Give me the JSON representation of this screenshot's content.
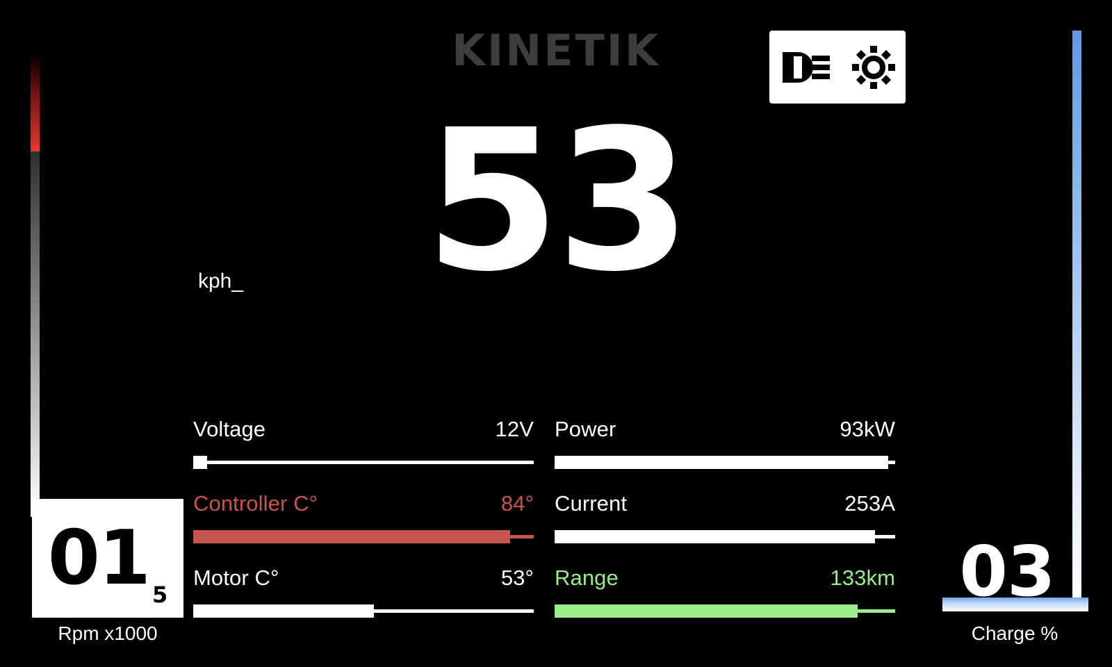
{
  "brand": {
    "name": "KINETIK"
  },
  "lights": {
    "low_beam_icon": "headlight-low-beam-icon",
    "brightness_icon": "brightness-sun-icon"
  },
  "speed": {
    "value": "53",
    "unit": "kph_"
  },
  "metrics": [
    {
      "label": "Voltage",
      "value": "12V",
      "fill_percent": 4,
      "color": "#ffffff",
      "style": ""
    },
    {
      "label": "Power",
      "value": "93kW",
      "fill_percent": 98,
      "color": "#ffffff",
      "style": ""
    },
    {
      "label": "Controller C°",
      "value": "84°",
      "fill_percent": 93,
      "color": "#c8544f",
      "style": "is-red"
    },
    {
      "label": "Current",
      "value": "253A",
      "fill_percent": 94,
      "color": "#ffffff",
      "style": ""
    },
    {
      "label": "Motor C°",
      "value": "53°",
      "fill_percent": 53,
      "color": "#ffffff",
      "style": ""
    },
    {
      "label": "Range",
      "value": "133km",
      "fill_percent": 89,
      "color": "#9aee86",
      "style": "is-green"
    }
  ],
  "rpm": {
    "value": "01",
    "decimal": "5",
    "caption": "Rpm x1000"
  },
  "charge": {
    "value": "03",
    "caption": "Charge %"
  },
  "gauges": {
    "left_hot_color": "#e03a33",
    "left_cool_color": "#ffffff",
    "right_color": "#5e9ae6"
  }
}
